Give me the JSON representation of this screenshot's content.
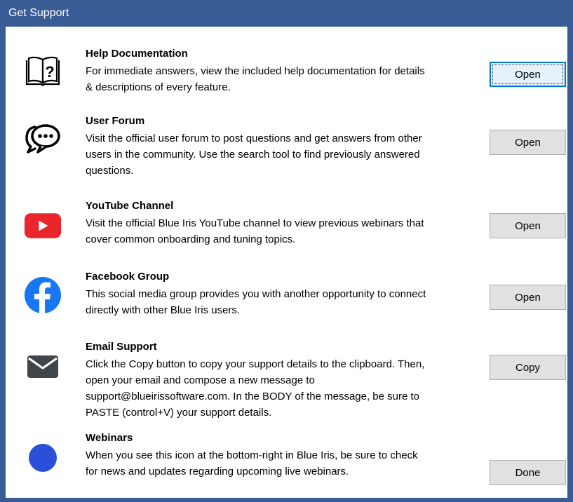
{
  "window": {
    "title": "Get Support"
  },
  "items": [
    {
      "title": "Help Documentation",
      "desc": "For immediate answers, view the included help documentation for details\n& descriptions of every feature.",
      "button": "Open",
      "icon": "book-question-icon"
    },
    {
      "title": "User Forum",
      "desc": "Visit the official user forum to post questions and get answers from other\nusers in the community.  Use the search tool to find previously answered\nquestions.",
      "button": "Open",
      "icon": "chat-bubbles-icon"
    },
    {
      "title": "YouTube Channel",
      "desc": "Visit the official Blue Iris YouTube channel to view previous webinars that\ncover common onboarding and tuning topics.",
      "button": "Open",
      "icon": "youtube-icon"
    },
    {
      "title": "Facebook Group",
      "desc": "This social media group provides you with another opportunity to connect\ndirectly with other Blue Iris users.",
      "button": "Open",
      "icon": "facebook-icon"
    },
    {
      "title": "Email Support",
      "desc": "Click the Copy button to copy your support details to the clipboard. Then,\nopen your email and compose a new message to\nsupport@blueirissoftware.com. In the BODY of the message, be sure to\nPASTE (control+V) your support details.",
      "button": "Copy",
      "icon": "envelope-icon"
    },
    {
      "title": "Webinars",
      "desc": "When you see this icon at the bottom-right in Blue Iris, be sure to check\nfor news and updates regarding upcoming live webinars.",
      "button": "Done",
      "icon": "blue-dot-icon"
    }
  ],
  "colors": {
    "titlebar": "#3a5c94",
    "youtube": "#e8262c",
    "facebook": "#1877f2",
    "envelope": "#3f4549",
    "webinar_dot": "#2b4fd8"
  }
}
